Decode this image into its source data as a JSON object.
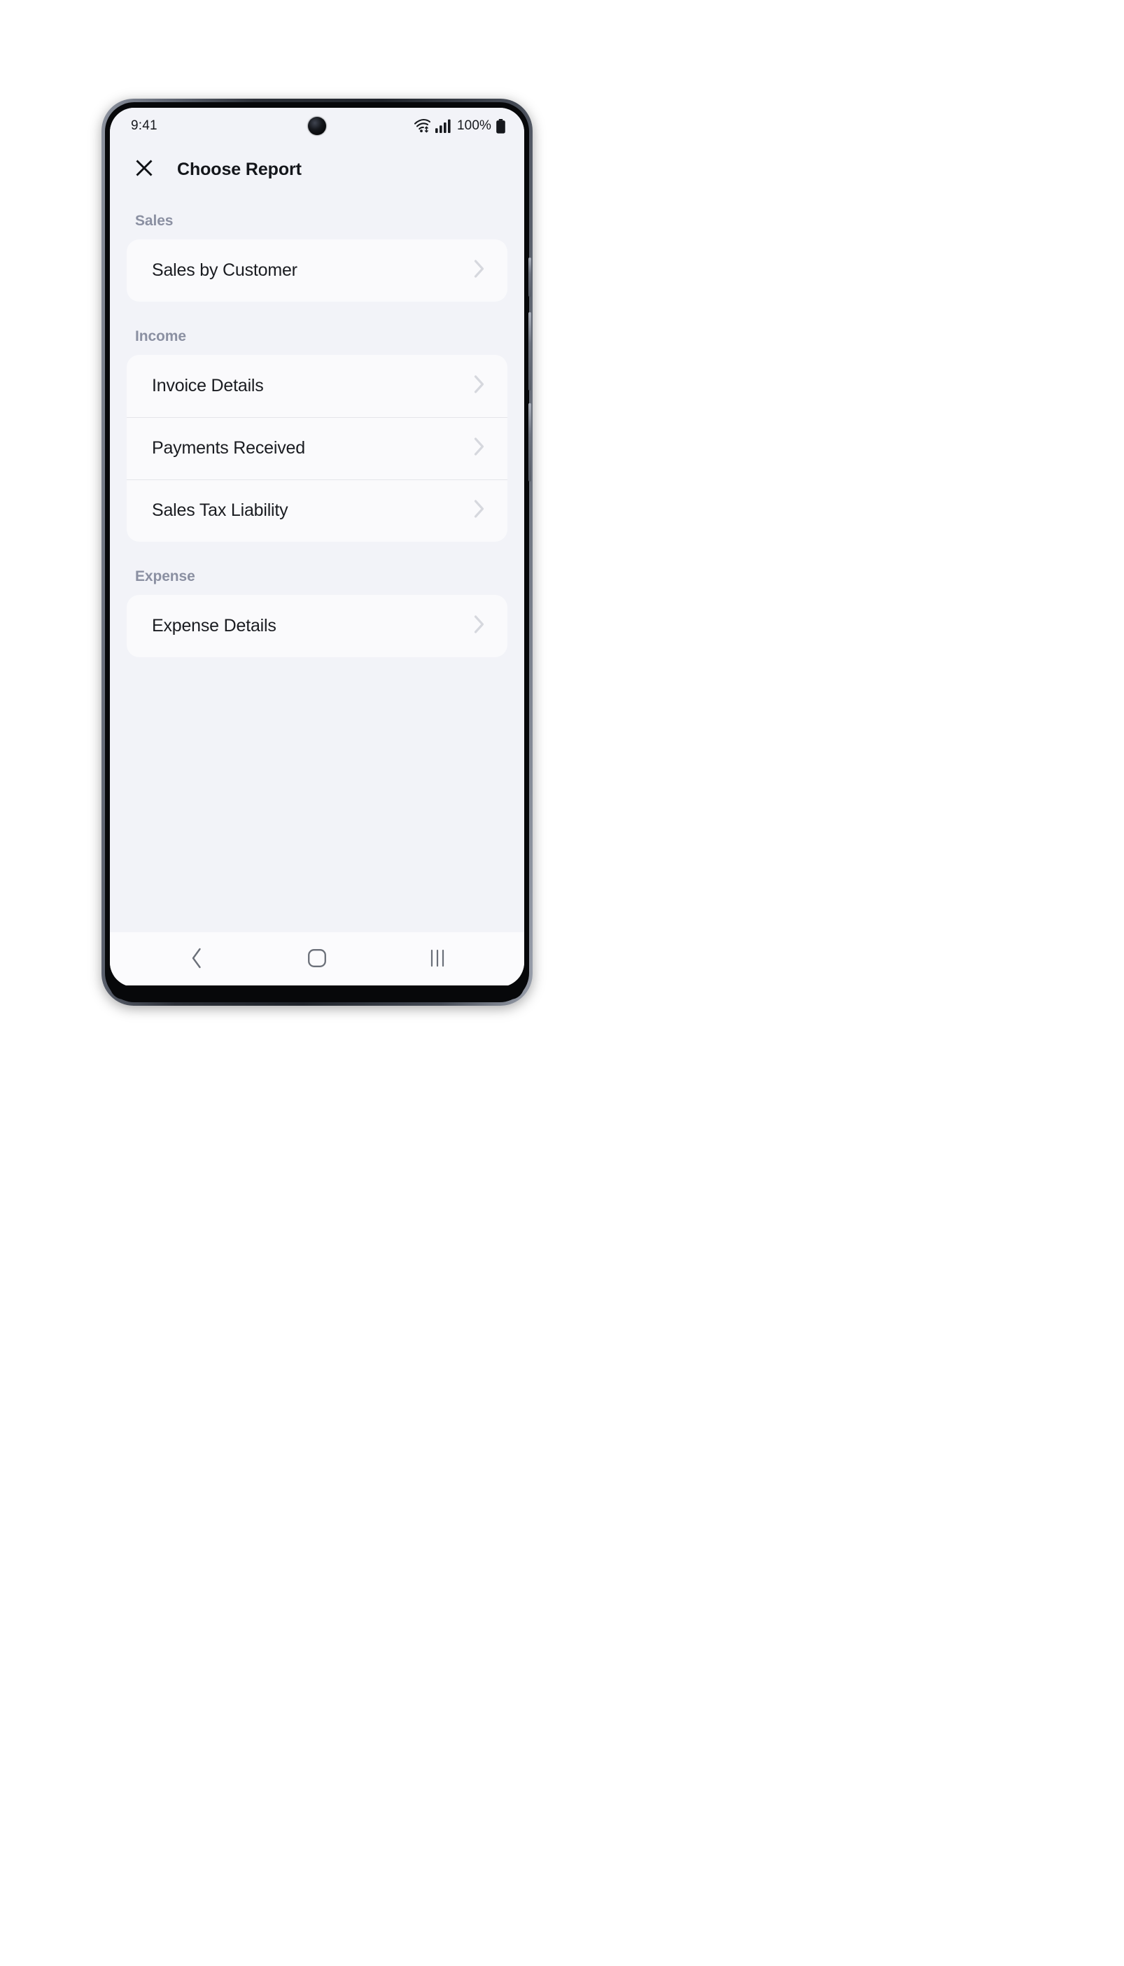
{
  "status_bar": {
    "time": "9:41",
    "battery_percent": "100%",
    "icons": [
      "wifi-icon",
      "cellular-signal-icon",
      "battery-icon"
    ]
  },
  "app_bar": {
    "close_icon": "close-icon",
    "title": "Choose Report"
  },
  "sections": [
    {
      "label": "Sales",
      "items": [
        {
          "label": "Sales by Customer",
          "chevron": "chevron-right-icon"
        }
      ]
    },
    {
      "label": "Income",
      "items": [
        {
          "label": "Invoice Details",
          "chevron": "chevron-right-icon"
        },
        {
          "label": "Payments Received",
          "chevron": "chevron-right-icon"
        },
        {
          "label": "Sales Tax Liability",
          "chevron": "chevron-right-icon"
        }
      ]
    },
    {
      "label": "Expense",
      "items": [
        {
          "label": "Expense Details",
          "chevron": "chevron-right-icon"
        }
      ]
    }
  ],
  "nav_bar": {
    "back": "back-icon",
    "home": "home-icon",
    "recents": "recents-icon"
  },
  "colors": {
    "screen_background": "#f2f3f8",
    "card_background": "#fafafc",
    "section_label": "#8b90a2",
    "row_label": "#1a1c21",
    "title": "#14161b",
    "chevron": "#d6d8de",
    "divider": "#e4e5ea",
    "nav_bar_background": "#fbfbfd",
    "nav_icon": "#6b7079"
  }
}
